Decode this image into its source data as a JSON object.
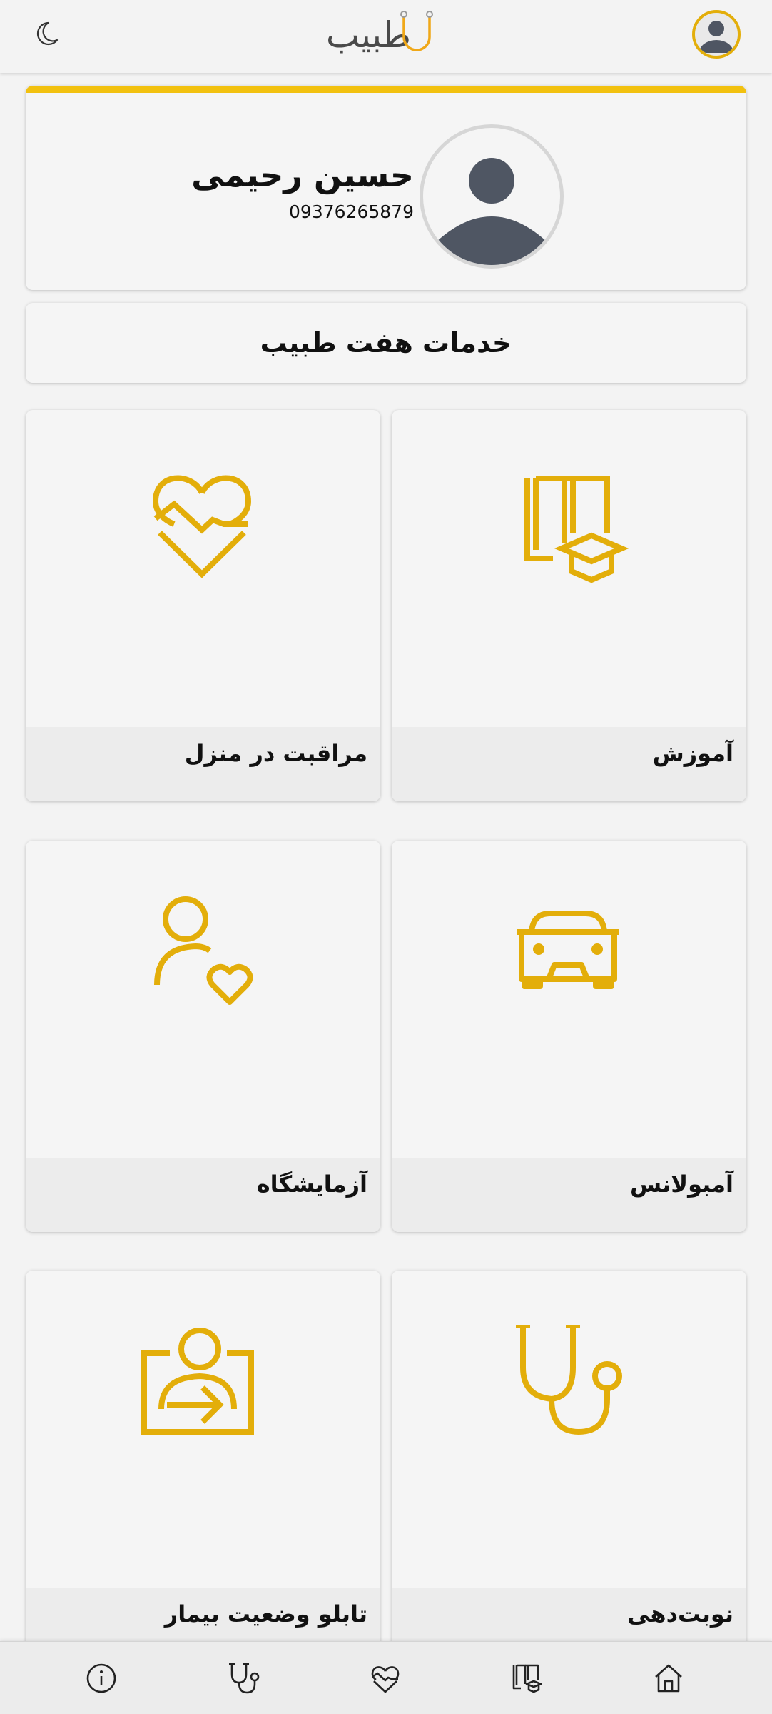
{
  "header": {
    "logo_text": "طبیب",
    "icons": {
      "theme": "moon-icon",
      "account": "user-avatar-icon"
    }
  },
  "profile": {
    "name": "حسین رحیمی",
    "phone": "09376265879"
  },
  "services": {
    "title": "خدمات هفت طبیب",
    "items": [
      {
        "label": "آموزش",
        "icon": "education-book-icon"
      },
      {
        "label": "مراقبت در منزل",
        "icon": "heart-pulse-icon"
      },
      {
        "label": "آمبولانس",
        "icon": "car-icon"
      },
      {
        "label": "آزمایشگاه",
        "icon": "person-heart-icon"
      },
      {
        "label": "نوبت‌دهی",
        "icon": "stethoscope-icon"
      },
      {
        "label": "تابلو وضعیت بیمار",
        "icon": "patient-board-icon"
      }
    ]
  },
  "bottom_nav": {
    "items": [
      "home-icon",
      "education-book-icon",
      "heart-pulse-icon",
      "stethoscope-icon",
      "info-icon"
    ]
  },
  "colors": {
    "accent": "#e3ae0a",
    "accent_bar": "#f2c10f",
    "avatar": "#4f5663",
    "background": "#f3f3f3"
  }
}
